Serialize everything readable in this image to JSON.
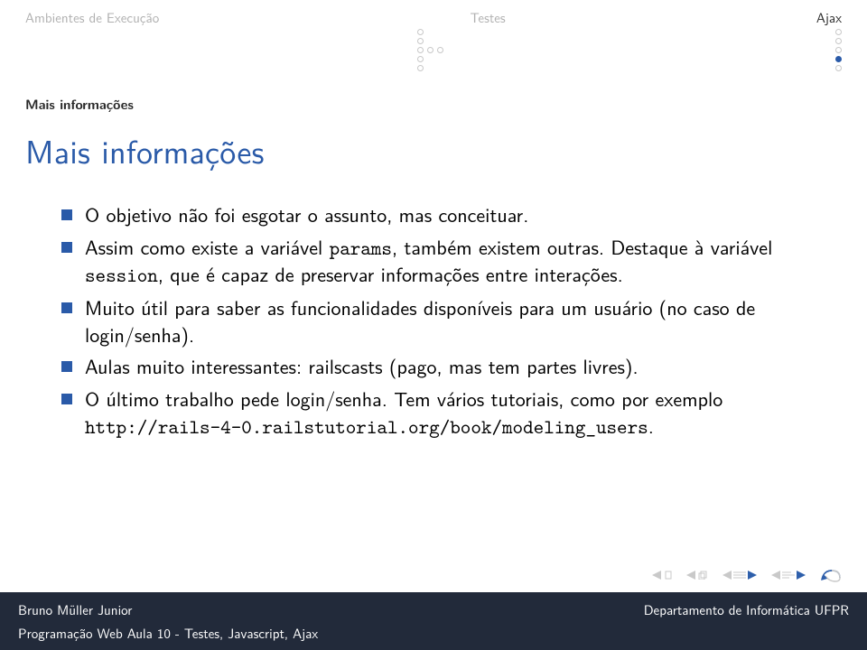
{
  "topbar": {
    "sections": [
      {
        "label": "Ambientes de Execução",
        "active": false
      },
      {
        "label": "Testes",
        "active": false
      },
      {
        "label": "Ajax",
        "active": true
      }
    ]
  },
  "subsection": "Mais informações",
  "title": "Mais informações",
  "bullets": [
    {
      "text": "O objetivo não foi esgotar o assunto, mas conceituar."
    },
    {
      "prefix": "Assim como existe a variável ",
      "code1": "params",
      "mid": ", também existem outras. Destaque à variável ",
      "code2": "session",
      "suffix": ", que é capaz de preservar informações entre interações."
    },
    {
      "text": "Muito útil para saber as funcionalidades disponíveis para um usuário (no caso de login/senha)."
    },
    {
      "text": "Aulas muito interessantes: railscasts (pago, mas tem partes livres)."
    },
    {
      "prefix": "O último trabalho pede login/senha. Tem vários tutoriais, como por exemplo ",
      "code1": "http://rails-4-0.railstutorial.org/book/modeling_users",
      "suffix": "."
    }
  ],
  "footer": {
    "author": "Bruno Müller Junior",
    "dept": "Departamento de Informática   UFPR",
    "lecture": "Programação Web   Aula 10 - Testes, Javascript, Ajax"
  }
}
